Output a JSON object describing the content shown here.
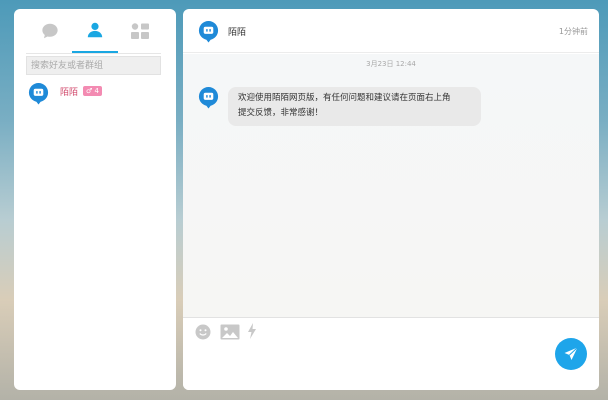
{
  "contacts_panel": {
    "tabs": [
      {
        "name": "recent-chats",
        "icon": "chat-bubble-icon",
        "active": false
      },
      {
        "name": "contacts",
        "icon": "person-icon",
        "active": true
      },
      {
        "name": "groups",
        "icon": "grid-icon",
        "active": false
      }
    ],
    "search_placeholder": "搜索好友或者群组",
    "contacts": [
      {
        "name": "陌陌",
        "badge": "♂ 4",
        "icon": "momo-logo-icon"
      }
    ]
  },
  "chat": {
    "title": "陌陌",
    "last_seen": "1分钟前",
    "date_separator": "3月23日 12:44",
    "messages": [
      {
        "sender_icon": "momo-logo-icon",
        "text_line1": "欢迎使用陌陌网页版，有任何问题和建议请在页面右上角",
        "text_line2": "提交反馈，非常感谢！"
      }
    ],
    "toolbar": [
      "emoji-icon",
      "image-icon",
      "lightning-icon"
    ],
    "send_icon": "send-icon"
  },
  "colors": {
    "accent": "#1aa7e2",
    "contact_name": "#d14a6c",
    "badge": "#f38bb2"
  }
}
